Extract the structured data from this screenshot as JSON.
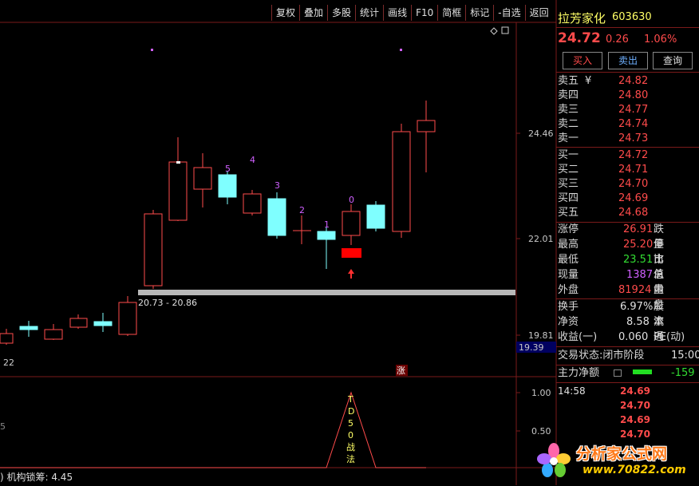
{
  "toolbar": [
    "复权",
    "叠加",
    "多股",
    "统计",
    "画线",
    "F10",
    "简框",
    "标记",
    "-自选",
    "返回"
  ],
  "chart": {
    "price_ticks": [
      "24.46",
      "22.01",
      "19.81"
    ],
    "current_price_tag": "19.39",
    "range_label": "20.73 - 20.86",
    "left_edge_label": "22",
    "zhang_badge": "涨",
    "countdown": [
      "5",
      "4",
      "3",
      "2",
      "1",
      "0"
    ],
    "indicator_ticks": [
      "1.00",
      "0.50"
    ],
    "td_text": [
      "T",
      "D",
      "5",
      "0",
      "战",
      "法"
    ],
    "bottom_indicator": "机构锁筹: 4.45",
    "left_small_label": "5"
  },
  "quote": {
    "name": "拉芳家化",
    "code": "603630",
    "price": "24.72",
    "change": "0.26",
    "change_pct": "1.06%",
    "buttons": [
      "买入",
      "卖出",
      "查询"
    ],
    "asks": [
      {
        "label": "卖五",
        "flag": "¥",
        "price": "24.82"
      },
      {
        "label": "卖四",
        "flag": "",
        "price": "24.80"
      },
      {
        "label": "卖三",
        "flag": "",
        "price": "24.77"
      },
      {
        "label": "卖二",
        "flag": "",
        "price": "24.74"
      },
      {
        "label": "卖一",
        "flag": "",
        "price": "24.73"
      }
    ],
    "bids": [
      {
        "label": "买一",
        "price": "24.72"
      },
      {
        "label": "买二",
        "price": "24.71"
      },
      {
        "label": "买三",
        "price": "24.70"
      },
      {
        "label": "买四",
        "price": "24.69"
      },
      {
        "label": "买五",
        "price": "24.68"
      }
    ],
    "stats": [
      {
        "label": "涨停",
        "value": "26.91",
        "right": "跌停"
      },
      {
        "label": "最高",
        "value": "25.20",
        "right": "量比"
      },
      {
        "label": "最低",
        "value": "23.51",
        "right": "市值"
      },
      {
        "label": "现量",
        "value": "1387",
        "right": "总量"
      },
      {
        "label": "外盘",
        "value": "81924",
        "right": "内盘"
      }
    ],
    "finance": [
      {
        "label": "换手",
        "value": "6.97%",
        "right": "股本"
      },
      {
        "label": "净资",
        "value": "8.58",
        "right": "流通"
      },
      {
        "label": "收益(一)",
        "value": "0.060",
        "right": "PE(动)"
      }
    ],
    "trade_status_label": "交易状态:",
    "trade_status_value": "闭市阶段",
    "trade_time": "15:00",
    "main_net_label": "主力净额",
    "main_net_value": "-159",
    "ticks": [
      {
        "time": "14:58",
        "price": "24.69"
      },
      {
        "time": "",
        "price": "24.70"
      },
      {
        "time": "",
        "price": "24.69"
      },
      {
        "time": "",
        "price": "24.70"
      }
    ]
  },
  "watermark": {
    "title": "分析家公式网",
    "url": "www.70822.com"
  },
  "colors": {
    "up": "#ff4b4b",
    "down_candle": "#7fffff",
    "grid": "#7a1a1a",
    "label_magenta": "#d060ff"
  }
}
